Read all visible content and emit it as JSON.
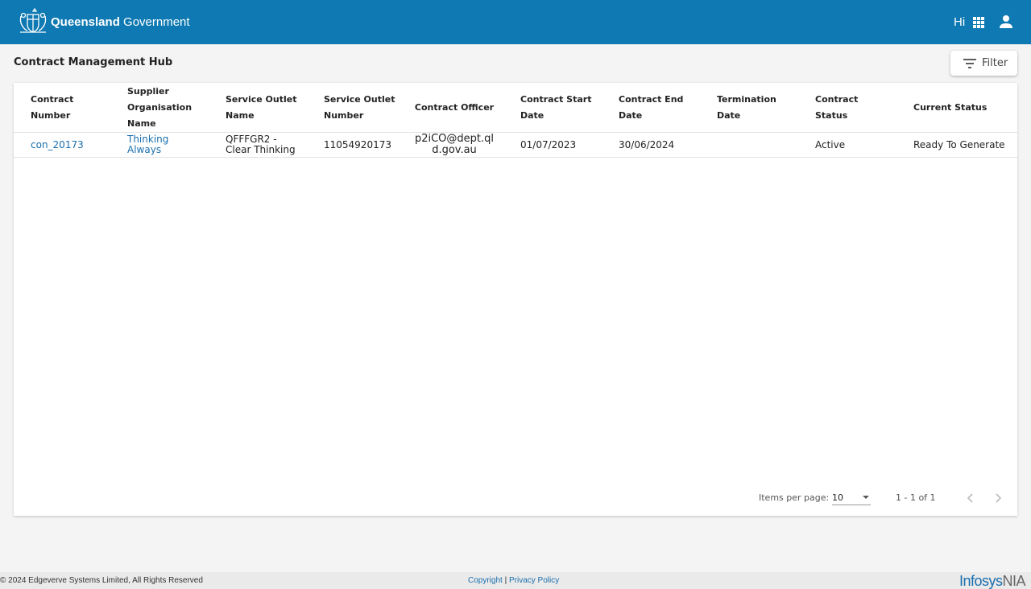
{
  "header": {
    "brand_bold": "Queensland",
    "brand_light": "Government",
    "greeting": "Hi",
    "colors": {
      "bar": "#0e79b2"
    }
  },
  "page": {
    "title": "Contract Management Hub",
    "filter_label": "Filter"
  },
  "table": {
    "columns": [
      "Contract Number",
      "Supplier Organisation Name",
      "Service Outlet Name",
      "Service Outlet Number",
      "Contract Officer",
      "Contract Start Date",
      "Contract End Date",
      "Termination Date",
      "Contract Status",
      "Current Status"
    ],
    "rows": [
      {
        "contract_number": "con_20173",
        "supplier": "Thinking Always",
        "outlet_name": "QFFFGR2 - Clear Thinking",
        "outlet_number": "11054920173",
        "officer": "p2iCO@dept.qld.gov.au",
        "start_date": "01/07/2023",
        "end_date": "30/06/2024",
        "termination_date": "",
        "contract_status": "Active",
        "current_status": "Ready To Generate"
      }
    ]
  },
  "paginator": {
    "items_per_page_label": "Items per page:",
    "items_per_page": "10",
    "range": "1 - 1 of 1"
  },
  "footer": {
    "copyright": "© 2024 Edgeverve Systems Limited, All Rights Reserved",
    "copyright_link": "Copyright",
    "separator": "|",
    "privacy_link": "Privacy Policy",
    "logo_main": "Infosys",
    "logo_suffix": "NIA"
  }
}
